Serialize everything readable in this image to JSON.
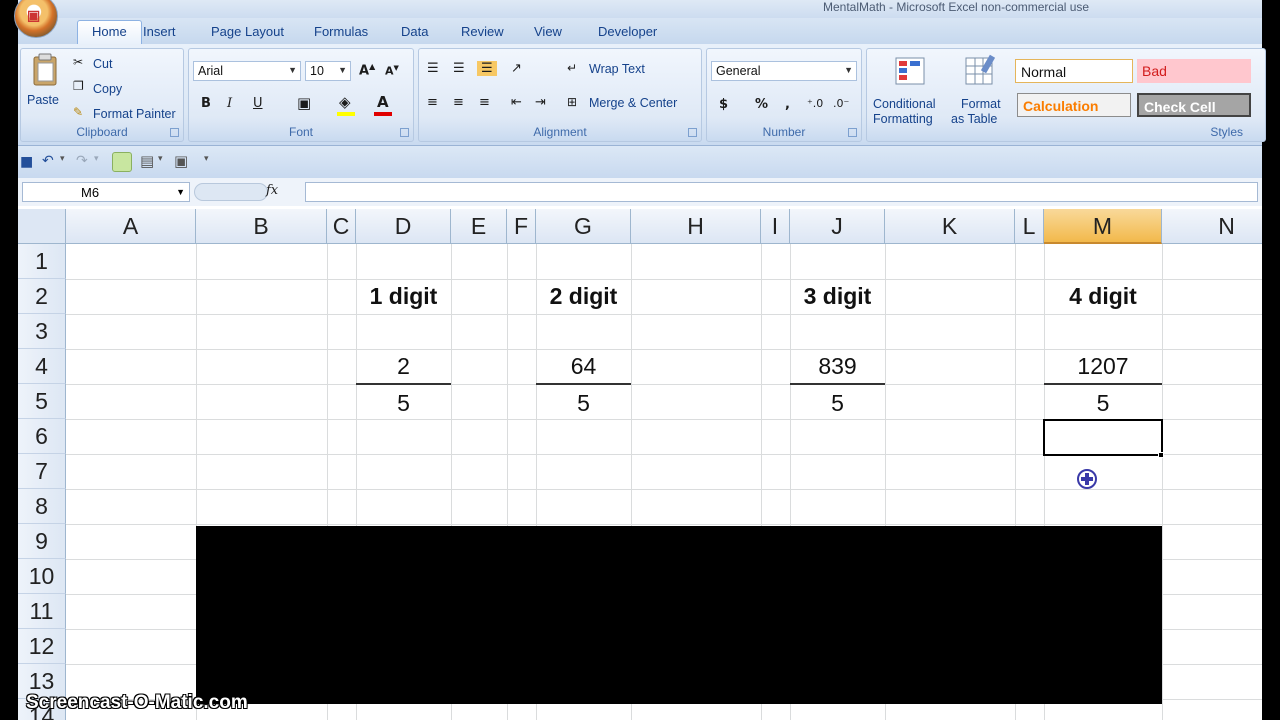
{
  "window": {
    "title": "MentalMath - Microsoft Excel non-commercial use"
  },
  "ribbon_tabs": [
    "Home",
    "Insert",
    "Page Layout",
    "Formulas",
    "Data",
    "Review",
    "View",
    "Developer"
  ],
  "clipboard": {
    "paste": "Paste",
    "cut": "Cut",
    "copy": "Copy",
    "format_painter": "Format Painter",
    "label": "Clipboard"
  },
  "font": {
    "name": "Arial",
    "size": "10",
    "label": "Font",
    "bold": "B",
    "italic": "I",
    "underline": "U"
  },
  "alignment": {
    "wrap_text": "Wrap Text",
    "merge_center": "Merge & Center",
    "label": "Alignment"
  },
  "number": {
    "format": "General",
    "currency": "$",
    "percent": "%",
    "comma": ",",
    "label": "Number"
  },
  "styles": {
    "conditional_formatting": [
      "Conditional",
      "Formatting"
    ],
    "format_as_table": [
      "Format",
      "as Table"
    ],
    "normal": "Normal",
    "bad": "Bad",
    "calculation": "Calculation",
    "check_cell": "Check Cell",
    "label": "Styles"
  },
  "formula_bar": {
    "name_box": "M6",
    "fx": "fx",
    "formula": ""
  },
  "columns": [
    "A",
    "B",
    "C",
    "D",
    "E",
    "F",
    "G",
    "H",
    "I",
    "J",
    "K",
    "L",
    "M",
    "N"
  ],
  "selected_column": "M",
  "rows": [
    "1",
    "2",
    "3",
    "4",
    "5",
    "6",
    "7",
    "8",
    "9",
    "10",
    "11",
    "12",
    "13",
    "14"
  ],
  "cells": {
    "D2": "1 digit",
    "G2": "2 digit",
    "J2": "3 digit",
    "M2": "4 digit",
    "D4": "2",
    "G4": "64",
    "J4": "839",
    "M4": "1207",
    "D5": "5",
    "G5": "5",
    "J5": "5",
    "M5": "5"
  },
  "active_cell": "M6",
  "watermark": "Screencast-O-Matic.com",
  "colors": {
    "accent": "#15428b",
    "selected_header": "#f2b94b",
    "bad_fill": "#ffc7ce",
    "check_cell_fill": "#a5a5a5"
  }
}
